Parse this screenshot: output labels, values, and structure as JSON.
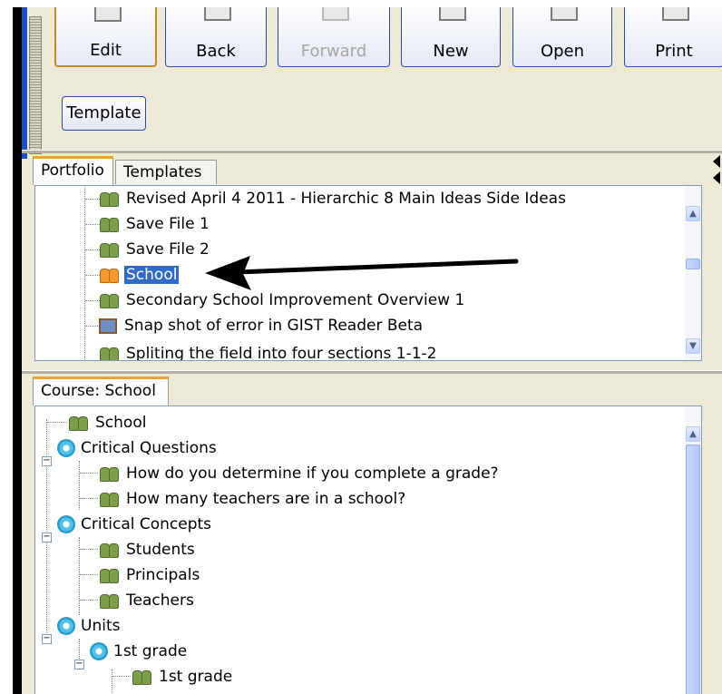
{
  "toolbar": {
    "edit_label": "Edit",
    "back_label": "Back",
    "forward_label": "Forward",
    "new_label": "New",
    "open_label": "Open",
    "print_label": "Print",
    "template_label": "Template"
  },
  "portfolio_panel": {
    "tabs": [
      "Portfolio",
      "Templates"
    ],
    "items": [
      {
        "label": "Revised April 4 2011 - Hierarchic 8 Main Ideas Side Ideas",
        "icon": "people-icon",
        "selected": false
      },
      {
        "label": "Save File 1",
        "icon": "people-icon",
        "selected": false
      },
      {
        "label": "Save File 2",
        "icon": "people-icon",
        "selected": false
      },
      {
        "label": "School",
        "icon": "people-icon",
        "selected": true
      },
      {
        "label": "Secondary School Improvement Overview 1",
        "icon": "people-icon",
        "selected": false
      },
      {
        "label": "Snap shot of error in GIST Reader Beta",
        "icon": "image-icon",
        "selected": false
      },
      {
        "label": "Spliting the field into four sections 1-1-2",
        "icon": "people-icon",
        "selected": false
      }
    ]
  },
  "course_panel": {
    "tab": "Course: School",
    "items": [
      {
        "label": "School",
        "icon": "people-icon"
      },
      {
        "label": "Critical Questions",
        "icon": "gear-icon"
      },
      {
        "label": "How do you determine if you complete a grade?",
        "icon": "people-icon"
      },
      {
        "label": "How many teachers are in a school?",
        "icon": "people-icon"
      },
      {
        "label": "Critical Concepts",
        "icon": "gear-icon"
      },
      {
        "label": "Students",
        "icon": "people-icon"
      },
      {
        "label": "Principals",
        "icon": "people-icon"
      },
      {
        "label": "Teachers",
        "icon": "people-icon"
      },
      {
        "label": "Units",
        "icon": "gear-icon"
      },
      {
        "label": "1st grade",
        "icon": "gear-icon"
      },
      {
        "label": "1st grade",
        "icon": "people-icon"
      }
    ]
  },
  "colors": {
    "selection": "#316ac5",
    "accent_tab": "#f0a230",
    "annotation_arrow": "#000000"
  }
}
